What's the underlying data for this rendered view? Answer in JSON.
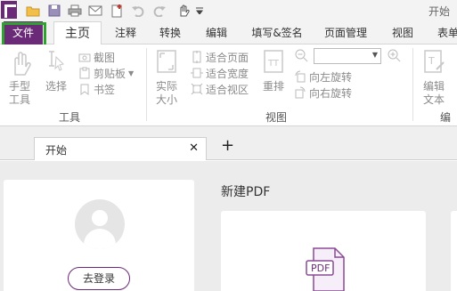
{
  "app": {
    "title": "开始",
    "accent": "#6b2a78",
    "highlight": "#2fa12f"
  },
  "quick_access": {
    "icons": [
      "app-logo-icon",
      "open-folder-icon",
      "save-icon",
      "print-icon",
      "email-icon",
      "new-doc-icon",
      "undo-icon",
      "redo-icon",
      "hand-select-icon",
      "customize-icon"
    ]
  },
  "tabs": [
    {
      "label": "文件"
    },
    {
      "label": "主页"
    },
    {
      "label": "注释"
    },
    {
      "label": "转换"
    },
    {
      "label": "编辑"
    },
    {
      "label": "填写&签名"
    },
    {
      "label": "页面管理"
    },
    {
      "label": "视图"
    },
    {
      "label": "表单"
    }
  ],
  "ribbon": {
    "tools": {
      "hand_label": "手型\n工具",
      "select_label": "选择",
      "screenshot_label": "截图",
      "clipboard_label": "剪贴板",
      "bookmark_label": "书签",
      "group": "工具"
    },
    "view": {
      "actual_size_label": "实际\n大小",
      "fit_page_label": "适合页面",
      "fit_width_label": "适合宽度",
      "fit_view_label": "适合视区",
      "reflow_label": "重排",
      "rotate_left_label": "向左旋转",
      "rotate_right_label": "向右旋转",
      "group": "视图"
    },
    "edit": {
      "edit_text_label": "编辑\n文本",
      "group": "编辑"
    }
  },
  "doc_tabs": [
    {
      "label": "开始"
    }
  ],
  "start": {
    "login_button": "去登录",
    "new_pdf_title": "新建PDF",
    "pdf_icon_text": "PDF"
  }
}
